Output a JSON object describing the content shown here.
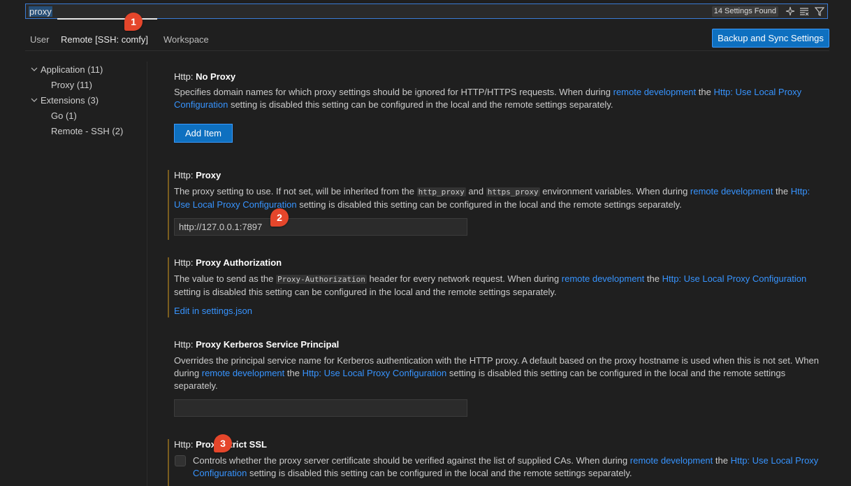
{
  "search": {
    "value": "proxy",
    "results_count": "14 Settings Found",
    "icons": [
      "sparkle-icon",
      "clear-filter-icon",
      "filter-icon"
    ]
  },
  "tabs": [
    {
      "label": "User",
      "active": false
    },
    {
      "label": "Remote [SSH: comfy]",
      "active": true
    },
    {
      "label": "Workspace",
      "active": false
    }
  ],
  "sync_button": "Backup and Sync Settings",
  "tree": [
    {
      "label": "Application (11)",
      "expanded": true,
      "level": 0
    },
    {
      "label": "Proxy (11)",
      "level": 1
    },
    {
      "label": "Extensions (3)",
      "expanded": true,
      "level": 0
    },
    {
      "label": "Go (1)",
      "level": 1
    },
    {
      "label": "Remote - SSH (2)",
      "level": 1
    }
  ],
  "settings": {
    "no_proxy": {
      "prefix": "Http: ",
      "name": "No Proxy",
      "desc_1": "Specifies domain names for which proxy settings should be ignored for HTTP/HTTPS requests. When during ",
      "link_1": "remote development",
      "desc_2": " the ",
      "link_2": "Http: Use Local Proxy Configuration",
      "desc_3": " setting is disabled this setting can be configured in the local and the remote settings separately.",
      "button": "Add Item"
    },
    "proxy": {
      "prefix": "Http: ",
      "name": "Proxy",
      "desc_1": "The proxy setting to use. If not set, will be inherited from the ",
      "code_1": "http_proxy",
      "desc_2": " and ",
      "code_2": "https_proxy",
      "desc_3": " environment variables. When during ",
      "link_1": "remote development",
      "desc_4": " the ",
      "link_2": "Http: Use Local Proxy Configuration",
      "desc_5": " setting is disabled this setting can be configured in the local and the remote settings separately.",
      "value": "http://127.0.0.1:7897"
    },
    "proxy_authorization": {
      "prefix": "Http: ",
      "name": "Proxy Authorization",
      "desc_1": "The value to send as the ",
      "code_1": "Proxy-Authorization",
      "desc_2": " header for every network request. When during ",
      "link_1": "remote development",
      "desc_3": " the ",
      "link_2": "Http: Use Local Proxy Configuration",
      "desc_4": " setting is disabled this setting can be configured in the local and the remote settings separately.",
      "edit_link": "Edit in settings.json"
    },
    "proxy_kerberos": {
      "prefix": "Http: ",
      "name": "Proxy Kerberos Service Principal",
      "desc_1": "Overrides the principal service name for Kerberos authentication with the HTTP proxy. A default based on the proxy hostname is used when this is not set. When during ",
      "link_1": "remote development",
      "desc_2": " the ",
      "link_2": "Http: Use Local Proxy Configuration",
      "desc_3": " setting is disabled this setting can be configured in the local and the remote settings separately.",
      "value": ""
    },
    "proxy_strict_ssl": {
      "prefix": "Http: ",
      "name": "Proxy Strict SSL",
      "desc_1": "Controls whether the proxy server certificate should be verified against the list of supplied CAs. When during ",
      "link_1": "remote development",
      "desc_2": " the ",
      "link_2": "Http: Use Local Proxy Configuration",
      "desc_3": " setting is disabled this setting can be configured in the local and the remote settings separately.",
      "checked": false
    }
  },
  "annotations": [
    "1",
    "2",
    "3"
  ],
  "colors": {
    "accent": "#0e70c0",
    "link": "#3794ff",
    "badge": "#e5462b",
    "modified_bar": "#7a5d1e"
  }
}
